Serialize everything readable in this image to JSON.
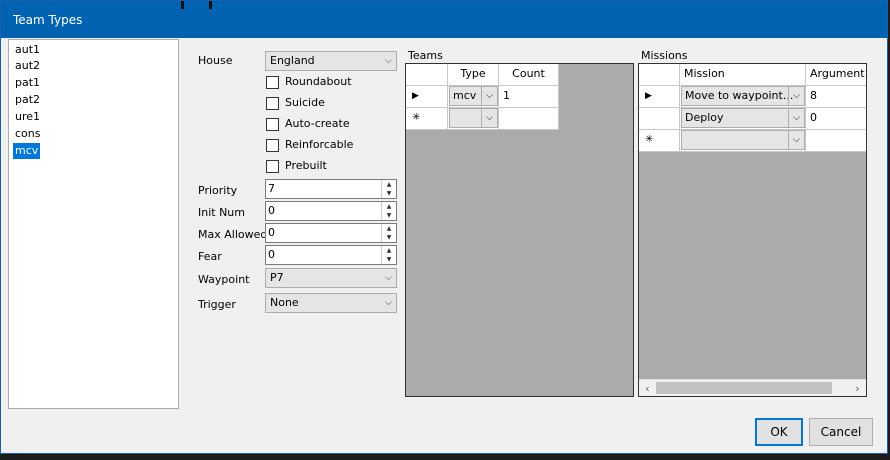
{
  "window": {
    "title": "Team Types"
  },
  "team_list": [
    "aut1",
    "aut2",
    "pat1",
    "pat2",
    "ure1",
    "cons",
    "mcv"
  ],
  "team_list_selected_index": 6,
  "form": {
    "house_label": "House",
    "house_value": "England",
    "checkboxes": [
      {
        "label": "Roundabout",
        "checked": false
      },
      {
        "label": "Suicide",
        "checked": false
      },
      {
        "label": "Auto-create",
        "checked": false
      },
      {
        "label": "Reinforcable",
        "checked": false
      },
      {
        "label": "Prebuilt",
        "checked": false
      }
    ],
    "priority_label": "Priority",
    "priority_value": "7",
    "init_num_label": "Init Num",
    "init_num_value": "0",
    "max_allowed_label": "Max Allowed",
    "max_allowed_value": "0",
    "fear_label": "Fear",
    "fear_value": "0",
    "waypoint_label": "Waypoint",
    "waypoint_value": "P7",
    "trigger_label": "Trigger",
    "trigger_value": "None"
  },
  "teams": {
    "label": "Teams",
    "headers": [
      "Type",
      "Count"
    ],
    "rows": [
      {
        "type": "mcv",
        "count": "1"
      }
    ]
  },
  "missions": {
    "label": "Missions",
    "headers": [
      "Mission",
      "Argument"
    ],
    "rows": [
      {
        "mission": "Move to waypoint...",
        "argument": "8"
      },
      {
        "mission": "Deploy",
        "argument": "0"
      }
    ]
  },
  "buttons": {
    "ok": "OK",
    "cancel": "Cancel"
  },
  "icons": {
    "dropdown": "chevron-down-icon",
    "row_current": "row-pointer-icon",
    "row_new": "new-row-icon"
  },
  "colors": {
    "titlebar": "#0063b1",
    "selection": "#0078d7",
    "grid_bg": "#ababab"
  }
}
